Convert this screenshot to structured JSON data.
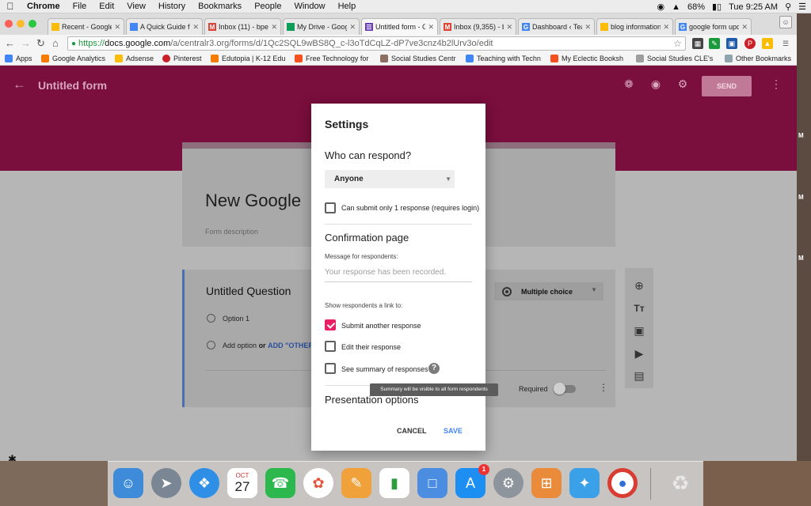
{
  "menubar": {
    "items": [
      "Chrome",
      "File",
      "Edit",
      "View",
      "History",
      "Bookmarks",
      "People",
      "Window",
      "Help"
    ],
    "battery": "68%",
    "clock": "Tue 9:25 AM"
  },
  "tabs": [
    {
      "label": "Recent - Google",
      "icon": "drive-icon",
      "color": "#fbbc05"
    },
    {
      "label": "A Quick Guide fo",
      "icon": "docs-icon",
      "color": "#4285f4"
    },
    {
      "label": "Inbox (11) - bpe",
      "icon": "gmail-icon",
      "color": "#db4437"
    },
    {
      "label": "My Drive - Goog",
      "icon": "drive-icon",
      "color": "#0f9d58"
    },
    {
      "label": "Untitled form - G",
      "icon": "forms-icon",
      "color": "#673ab7"
    },
    {
      "label": "Inbox (9,355) - b",
      "icon": "gmail-icon",
      "color": "#db4437"
    },
    {
      "label": "Dashboard ‹ Tea",
      "icon": "google-icon",
      "color": "#4285f4"
    },
    {
      "label": "blog information",
      "icon": "drive-icon",
      "color": "#fbbc05"
    },
    {
      "label": "google form upd",
      "icon": "google-icon",
      "color": "#4285f4"
    }
  ],
  "omnibox": {
    "scheme": "https://",
    "host": "docs.google.com",
    "path": "/a/centralr3.org/forms/d/1Qc2SQL9wBS8Q_c-l3oTdCqLZ-dP7ve3cnz4b2lUrv3o/edit"
  },
  "bookmarks": [
    {
      "label": "Apps",
      "color": "#4285f4"
    },
    {
      "label": "Google Analytics",
      "color": "#f57c00"
    },
    {
      "label": "Adsense",
      "color": "#fbbc05"
    },
    {
      "label": "Pinterest",
      "color": "#cb2027"
    },
    {
      "label": "Edutopia | K-12 Edu",
      "color": "#f57c00"
    },
    {
      "label": "Free Technology for",
      "color": "#f4511e"
    },
    {
      "label": "Social Studies Centr",
      "color": "#8d6e63"
    },
    {
      "label": "Teaching with Techn",
      "color": "#4285f4"
    },
    {
      "label": "My Eclectic Booksh",
      "color": "#f4511e"
    },
    {
      "label": "Social Studies CLE's",
      "color": "#9e9e9e"
    },
    {
      "label": "Other Bookmarks",
      "color": "#90a4ae"
    }
  ],
  "form": {
    "header_title": "Untitled form",
    "send_label": "SEND",
    "title": "New Google",
    "description": "Form description",
    "question_title": "Untitled Question",
    "option1": "Option 1",
    "add_option": "Add option",
    "or": "or",
    "add_other": "ADD \"OTHER\"",
    "question_type": "Multiple choice",
    "required": "Required",
    "header_color": "#7a0e3c"
  },
  "settings": {
    "title": "Settings",
    "who_can_respond": "Who can respond?",
    "respond_value": "Anyone",
    "submit_once": "Can submit only 1 response (requires login)",
    "submit_once_checked": false,
    "confirmation_heading": "Confirmation page",
    "message_label": "Message for respondents:",
    "message_placeholder": "Your response has been recorded.",
    "links_label": "Show respondents a link to:",
    "submit_another": "Submit another response",
    "submit_another_checked": true,
    "edit_response": "Edit their response",
    "edit_response_checked": false,
    "see_summary": "See summary of responses",
    "see_summary_checked": false,
    "tooltip": "Summary will be visible to all form respondents",
    "presentation_heading": "Presentation options",
    "cancel": "CANCEL",
    "save": "SAVE",
    "accent_color": "#e91e63"
  },
  "dock": {
    "calendar_month": "OCT",
    "calendar_day": "27",
    "appstore_badge": "1"
  }
}
